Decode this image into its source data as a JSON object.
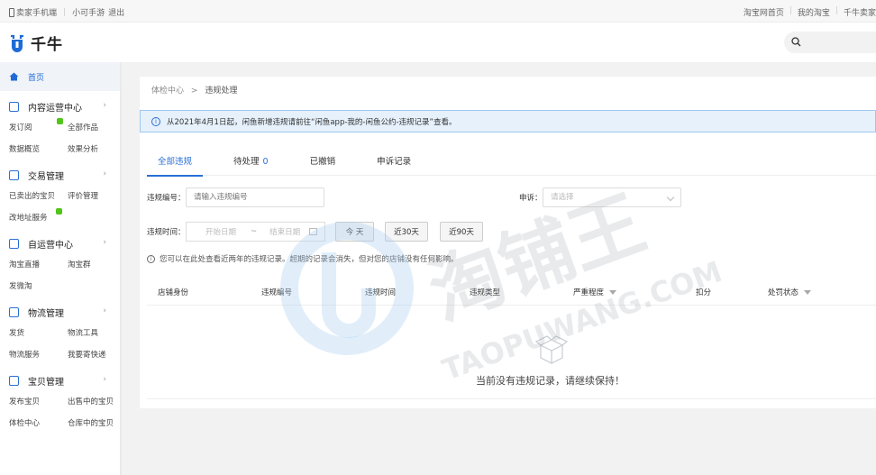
{
  "topbar": {
    "seller_mobile": "卖家手机端",
    "game": "小可手游",
    "logout": "退出",
    "taobao_home": "淘宝网首页",
    "my_taobao": "我的淘宝",
    "qianniu_seller": "千牛卖家"
  },
  "header": {
    "logo_text": "千牛"
  },
  "sidebar": {
    "home": "首页",
    "groups": [
      {
        "title": "内容运营中心",
        "rows": [
          [
            "发订阅",
            "全部作品"
          ],
          [
            "数据概览",
            "效果分析"
          ]
        ]
      },
      {
        "title": "交易管理",
        "rows": [
          [
            "已卖出的宝贝",
            "评价管理"
          ],
          [
            "改地址服务",
            ""
          ]
        ]
      },
      {
        "title": "自运营中心",
        "rows": [
          [
            "淘宝直播",
            "淘宝群"
          ],
          [
            "发微淘",
            ""
          ]
        ]
      },
      {
        "title": "物流管理",
        "rows": [
          [
            "发货",
            "物流工具"
          ],
          [
            "物流服务",
            "我要寄快递"
          ]
        ]
      },
      {
        "title": "宝贝管理",
        "rows": [
          [
            "发布宝贝",
            "出售中的宝贝"
          ],
          [
            "体检中心",
            "仓库中的宝贝"
          ]
        ]
      }
    ]
  },
  "main": {
    "breadcrumb": {
      "parent": "体检中心",
      "sep": ">",
      "current": "违规处理"
    },
    "notice": "从2021年4月1日起，闲鱼新增违规请前往“闲鱼app-我的-闲鱼公约-违规记录”查看。",
    "tabs": [
      {
        "label": "全部违规",
        "badge": ""
      },
      {
        "label": "待处理",
        "badge": "0"
      },
      {
        "label": "已撤销",
        "badge": ""
      },
      {
        "label": "申诉记录",
        "badge": ""
      }
    ],
    "form": {
      "violation_no_label": "违规编号：",
      "violation_no_placeholder": "请输入违规编号",
      "appeal_label": "申诉：",
      "appeal_placeholder": "请选择",
      "time_label": "违规时间：",
      "start_date": "开始日期",
      "tilde": "~",
      "end_date": "结束日期",
      "btn_today": "今 天",
      "btn_30": "近30天",
      "btn_90": "近90天"
    },
    "hint": "您可以在此处查看近两年的违规记录。超期的记录会消失，但对您的店铺没有任何影响。",
    "table_headers": [
      "店铺身份",
      "违规编号",
      "违规时间",
      "违规类型",
      "严重程度",
      "扣分",
      "处罚状态"
    ],
    "empty_text": "当前没有违规记录，请继续保持！"
  },
  "watermark": {
    "cn": "淘铺王",
    "en": "TAOPUWANG.COM"
  },
  "colors": {
    "accent": "#2a6fd6",
    "notice_bg": "#e6f1fc",
    "new_badge": "#52c41a"
  }
}
